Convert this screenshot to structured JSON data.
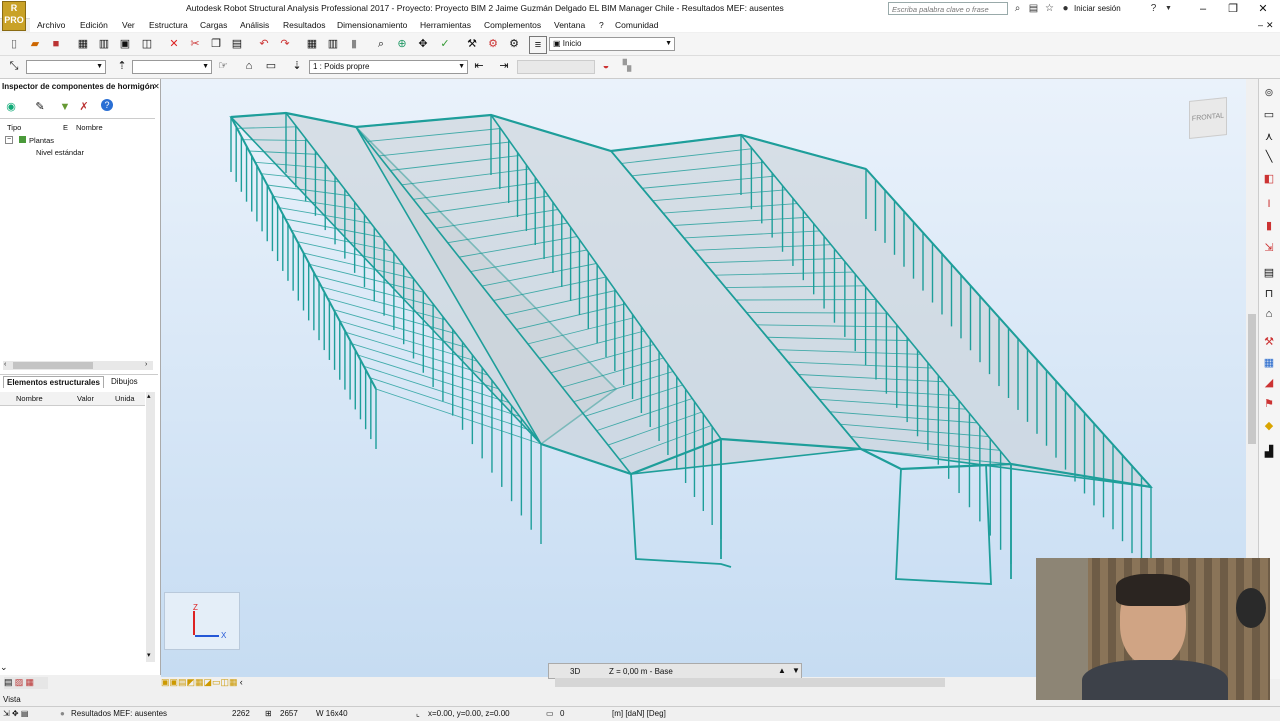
{
  "title_bar": {
    "app_logo": "PRO",
    "title": "Autodesk Robot Structural Analysis Professional 2017 - Proyecto: Proyecto BIM 2 Jaime Guzmán Delgado EL BIM Manager Chile - Resultados MEF: ausentes",
    "search_placeholder": "Escriba palabra clave o frase",
    "sign_in": "Iniciar sesión"
  },
  "menu": [
    "Archivo",
    "Edición",
    "Ver",
    "Estructura",
    "Cargas",
    "Análisis",
    "Resultados",
    "Dimensionamiento",
    "Herramientas",
    "Complementos",
    "Ventana",
    "?",
    "Comunidad"
  ],
  "toolbar1": {
    "layout_combo": "Inicio"
  },
  "toolbar2": {
    "load_case_combo": "1 : Poids propre"
  },
  "left_panel": {
    "title": "Inspector de componentes de hormigón",
    "columns": [
      "Tipo",
      "E",
      "Nombre"
    ],
    "tree": {
      "root": "Plantas",
      "child": "Nivel estándar"
    },
    "tabs": [
      "Elementos estructurales",
      "Dibujos"
    ],
    "prop_columns": [
      "Nombre",
      "Valor",
      "Unida"
    ]
  },
  "viewport": {
    "view_cube_label": "FRONTAL",
    "axis_z": "Z",
    "axis_x": "X"
  },
  "view_status": {
    "mode": "3D",
    "level": "Z = 0,00 m - Base"
  },
  "status_bar": {
    "view_label": "Vista",
    "results": "Resultados MEF: ausentes",
    "nodes": "2262",
    "bars": "2657",
    "section": "W 16x40",
    "coords": "x=0.00, y=0.00, z=0.00",
    "zero": "0",
    "units": "[m] [daN] [Deg]"
  },
  "colors": {
    "structure": "#1e9e9a",
    "roof_panel": "#c9cfd6",
    "accent": "#c9a227"
  }
}
